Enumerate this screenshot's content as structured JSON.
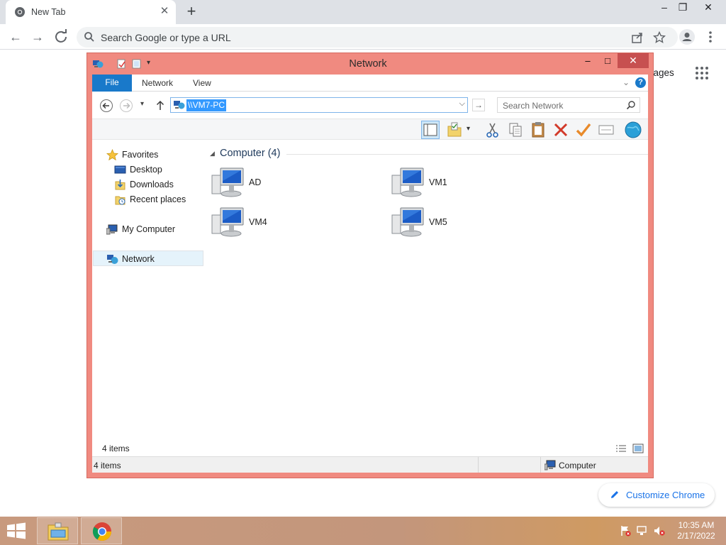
{
  "browser": {
    "tab_title": "New Tab",
    "omnibox_placeholder": "Search Google or type a URL",
    "ntp_images_label": "nages",
    "customize_label": "Customize Chrome"
  },
  "explorer": {
    "title": "Network",
    "ribbon_tabs": [
      "File",
      "Network",
      "View"
    ],
    "address": "\\\\VM7-PC",
    "search_placeholder": "Search Network",
    "nav": {
      "favorites": "Favorites",
      "desktop": "Desktop",
      "downloads": "Downloads",
      "recent": "Recent places",
      "my_computer": "My Computer",
      "network": "Network"
    },
    "group_title": "Computer (4)",
    "computers": [
      "AD",
      "VM1",
      "VM4",
      "VM5"
    ],
    "status_inner": "4 items",
    "status_outer_left": "4 items",
    "status_outer_right": "Computer"
  },
  "taskbar": {
    "time": "10:35 AM",
    "date": "2/17/2022"
  },
  "colors": {
    "window_frame": "#f08a80",
    "file_tab": "#1979ca",
    "selection": "#3399ff",
    "chrome_link": "#1a73e8"
  }
}
